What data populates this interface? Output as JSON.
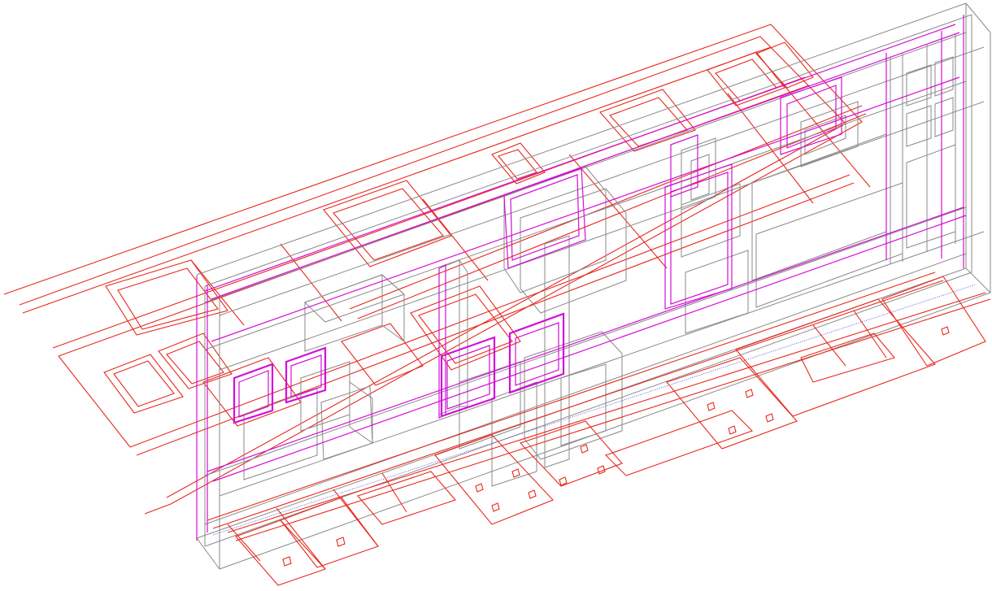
{
  "drawing": {
    "type": "isometric-wireframe",
    "background_color": "#ffffff",
    "layer_colors": {
      "floor_plan_outline": "#e8271d",
      "wall_geometry": "#8a8a8a",
      "highlight_openings": "#d40fd6",
      "center_line": "#3a3ad0"
    }
  }
}
